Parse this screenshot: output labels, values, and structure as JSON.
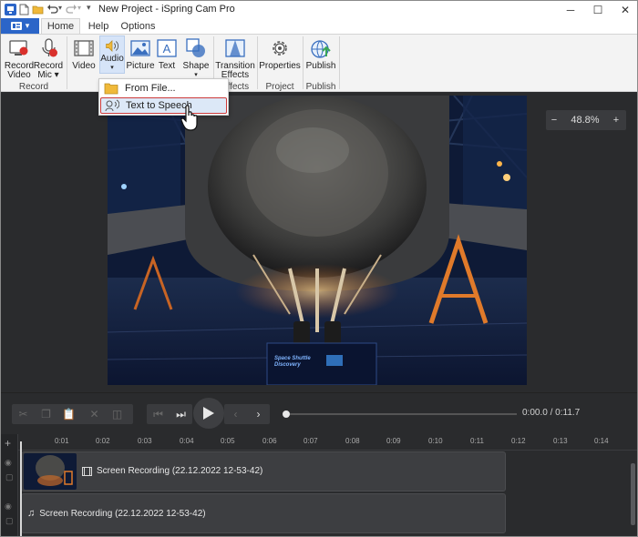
{
  "window": {
    "title": "New Project - iSpring Cam Pro",
    "minimize": "─",
    "maximize": "☐",
    "close": "✕"
  },
  "tabs": {
    "app_button": "▾",
    "items": [
      {
        "label": "Home"
      },
      {
        "label": "Help"
      },
      {
        "label": "Options"
      }
    ]
  },
  "ribbon": {
    "record_video": [
      "Record",
      "Video"
    ],
    "record_mic": [
      "Record",
      "Mic ▾"
    ],
    "video": "Video",
    "audio": [
      "Audio",
      "▾"
    ],
    "picture": "Picture",
    "text": "Text",
    "shape": [
      "Shape",
      "▾"
    ],
    "transition": [
      "Transition",
      "Effects"
    ],
    "properties": "Properties",
    "publish": "Publish",
    "groups": {
      "record": "Record",
      "effects": "Effects",
      "project": "Project",
      "publish": "Publish"
    }
  },
  "audio_menu": {
    "items": [
      {
        "label": "From File..."
      },
      {
        "label": "Text to Speech"
      }
    ]
  },
  "preview": {
    "zoom": "48.8%",
    "zoom_minus": "−",
    "zoom_plus": "+",
    "placard_line1": "Space Shuttle",
    "placard_line2": "Discovery"
  },
  "playback": {
    "time_current": "0:00.0",
    "time_separator": " / ",
    "time_total": "0:11.7"
  },
  "timeline": {
    "ticks": [
      "0:01",
      "0:02",
      "0:03",
      "0:04",
      "0:05",
      "0:06",
      "0:07",
      "0:08",
      "0:09",
      "0:10",
      "0:11",
      "0:12",
      "0:13",
      "0:14"
    ],
    "video_track": "Screen Recording (22.12.2022 12-53-42)",
    "audio_track": "Screen Recording (22.12.2022 12-53-42)",
    "add": "+"
  },
  "colors": {
    "accent": "#2b65c8",
    "ribbon_bg": "#f3f3f3",
    "editor_bg": "#2a2b2d",
    "highlight_border": "#cc3a3a"
  }
}
